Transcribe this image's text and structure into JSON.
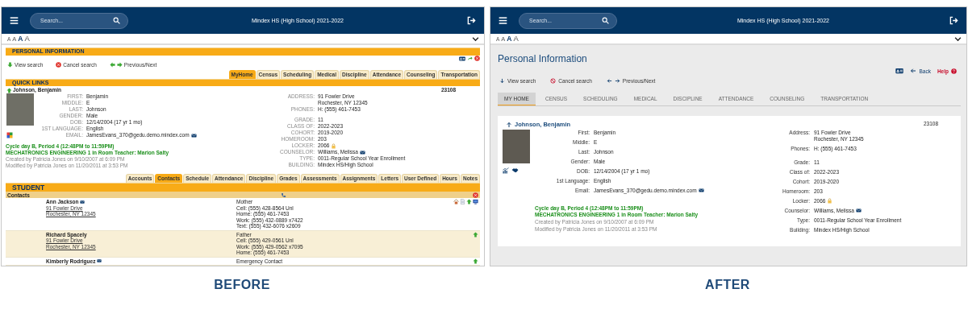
{
  "before": {
    "header": {
      "search_placeholder": "Search...",
      "title": "Mindex HS (High School) 2021-2022"
    },
    "font_sizes": [
      {
        "label": "A",
        "selected": false
      },
      {
        "label": "A",
        "selected": false
      },
      {
        "label": "A",
        "selected": true
      },
      {
        "label": "A",
        "selected": false
      }
    ],
    "section_title": "PERSONAL INFORMATION",
    "actions": [
      {
        "kind": "view",
        "label": "View search"
      },
      {
        "kind": "cancel",
        "label": "Cancel search"
      },
      {
        "kind": "prevnext",
        "label": "Previous/Next"
      }
    ],
    "tabs": [
      {
        "label": "MyHome",
        "selected": true
      },
      {
        "label": "Census",
        "selected": false
      },
      {
        "label": "Scheduling",
        "selected": false
      },
      {
        "label": "Medical",
        "selected": false
      },
      {
        "label": "Discipline",
        "selected": false
      },
      {
        "label": "Attendance",
        "selected": false
      },
      {
        "label": "Counseling",
        "selected": false
      },
      {
        "label": "Transportation",
        "selected": false
      }
    ],
    "quick_links_title": "QUICK LINKS",
    "student_name": "Johnson, Benjamin",
    "student_id": "23108",
    "left_fields": [
      {
        "kind": "text",
        "label": "FIRST:",
        "value": "Benjamin"
      },
      {
        "kind": "text",
        "label": "MIDDLE:",
        "value": "E"
      },
      {
        "kind": "text",
        "label": "LAST:",
        "value": "Johnson"
      },
      {
        "kind": "text",
        "label": "GENDER:",
        "value": "Male"
      },
      {
        "kind": "text",
        "label": "DOB:",
        "value": "12/14/2004 (17 yr 1 mo)"
      },
      {
        "kind": "text",
        "label": "1ST LANGUAGE:",
        "value": "English"
      },
      {
        "kind": "mail",
        "label": "EMAIL:",
        "value": "JamesEvans_370@gedu.demo.mindex.com"
      }
    ],
    "right_groups": [
      [
        {
          "kind": "text",
          "label": "ADDRESS:",
          "value": "91 Fowler Drive\nRochester, NY 12345"
        },
        {
          "kind": "text",
          "label": "PHONES:",
          "value": "H: (555) 461-7453"
        }
      ],
      [
        {
          "kind": "text",
          "label": "GRADE:",
          "value": "11"
        },
        {
          "kind": "text",
          "label": "CLASS OF:",
          "value": "2022-2023"
        },
        {
          "kind": "text",
          "label": "COHORT:",
          "value": "2019-2020"
        },
        {
          "kind": "text",
          "label": "HOMEROOM:",
          "value": "203"
        },
        {
          "kind": "lock",
          "label": "LOCKER:",
          "value": "2066"
        },
        {
          "kind": "mail",
          "label": "COUNSELOR:",
          "value": "Williams, Melissa"
        },
        {
          "kind": "text",
          "label": "TYPE:",
          "value": "0011-Regular School Year Enrollment"
        },
        {
          "kind": "text",
          "label": "BUILDING:",
          "value": "Mindex HS/High School"
        }
      ]
    ],
    "schedule_lines": [
      "Cycle day B, Period 4 (12:48PM to 11:59PM)",
      "MECHATRONICS ENGINEERING 1 in Room Teacher: Marion Salty"
    ],
    "audit_lines": [
      "Created by Patricia Jones on 9/10/2007 at 6:09 PM",
      "Modified by Patricia Jones on 11/20/2011 at 3:53 PM"
    ],
    "student_tabs": [
      {
        "label": "Accounts",
        "selected": false
      },
      {
        "label": "Contacts",
        "selected": true
      },
      {
        "label": "Schedule",
        "selected": false
      },
      {
        "label": "Attendance",
        "selected": false
      },
      {
        "label": "Discipline",
        "selected": false
      },
      {
        "label": "Grades",
        "selected": false
      },
      {
        "label": "Assessments",
        "selected": false
      },
      {
        "label": "Assignments",
        "selected": false
      },
      {
        "label": "Letters",
        "selected": false
      },
      {
        "label": "User Defined",
        "selected": false
      },
      {
        "label": "Hours",
        "selected": false
      },
      {
        "label": "Notes",
        "selected": false
      }
    ],
    "student_title": "STUDENT",
    "contacts_title": "Contacts",
    "contacts": [
      {
        "name": "Ann Jackson",
        "emailable": true,
        "primary": true,
        "address": "91 Fowler Drive\nRochester, NY 12345",
        "relation": "Mother",
        "phones": [
          "Cell: (555) 428-8564 Unl",
          "Home: (555) 461-7453",
          "Work: (555) 432-0889 x7422",
          "Text: (555) 432-6076 x2609"
        ]
      },
      {
        "name": "Richard Spacely",
        "emailable": false,
        "primary": false,
        "address": "91 Fowler Drive\nRochester, NY 12345",
        "relation": "Father",
        "phones": [
          "Cell: (555) 429-0561 Unl",
          "Work: (555) 429-0562 x7095",
          "Home: (555) 461-7453"
        ]
      },
      {
        "name": "Kimberly Rodriguez",
        "emailable": true,
        "primary": false,
        "relation": "Emergency Contact"
      }
    ]
  },
  "after": {
    "header": {
      "search_placeholder": "Search...",
      "title": "Mindex HS (High School) 2021-2022"
    },
    "font_sizes": [
      {
        "label": "A",
        "selected": false
      },
      {
        "label": "A",
        "selected": false
      },
      {
        "label": "A",
        "selected": true
      },
      {
        "label": "A",
        "selected": false
      }
    ],
    "page_title": "Personal Information",
    "back_label": "Back",
    "help_label": "Help",
    "actions": [
      {
        "kind": "view",
        "label": "View search"
      },
      {
        "kind": "cancel",
        "label": "Cancel search"
      },
      {
        "kind": "prevnext",
        "label": "Previous/Next"
      }
    ],
    "tabs": [
      {
        "label": "MY HOME",
        "selected": true
      },
      {
        "label": "CENSUS",
        "selected": false
      },
      {
        "label": "SCHEDULING",
        "selected": false
      },
      {
        "label": "MEDICAL",
        "selected": false
      },
      {
        "label": "DISCIPLINE",
        "selected": false
      },
      {
        "label": "ATTENDANCE",
        "selected": false
      },
      {
        "label": "COUNSELING",
        "selected": false
      },
      {
        "label": "TRANSPORTATION",
        "selected": false
      }
    ],
    "student_name": "Johnson, Benjamin",
    "student_id": "23108",
    "left_fields": [
      {
        "kind": "text",
        "label": "First:",
        "value": "Benjamin"
      },
      {
        "kind": "text",
        "label": "Middle:",
        "value": "E"
      },
      {
        "kind": "text",
        "label": "Last:",
        "value": "Johnson"
      },
      {
        "kind": "text",
        "label": "Gender:",
        "value": "Male"
      },
      {
        "kind": "text",
        "label": "DOB:",
        "value": "12/14/2004 (17 yr 1 mo)"
      },
      {
        "kind": "text",
        "label": "1st Language:",
        "value": "English"
      },
      {
        "kind": "mail",
        "label": "Email:",
        "value": "JamesEvans_370@gedu.demo.mindex.com"
      }
    ],
    "right_groups": [
      [
        {
          "kind": "text",
          "label": "Address:",
          "value": "91 Fowler Drive\nRochester, NY 12345"
        },
        {
          "kind": "text",
          "label": "Phones:",
          "value": "H:  (555) 461-7453"
        }
      ],
      [
        {
          "kind": "text",
          "label": "Grade:",
          "value": "11"
        },
        {
          "kind": "text",
          "label": "Class of:",
          "value": "2022-2023"
        },
        {
          "kind": "text",
          "label": "Cohort:",
          "value": "2019-2020"
        },
        {
          "kind": "text",
          "label": "Homeroom:",
          "value": "203"
        },
        {
          "kind": "lock",
          "label": "Locker:",
          "value": "2066"
        },
        {
          "kind": "mail",
          "label": "Counselor:",
          "value": "Williams, Melissa"
        },
        {
          "kind": "text",
          "label": "Type:",
          "value": "0011-Regular School Year Enrollment"
        },
        {
          "kind": "text",
          "label": "Building:",
          "value": "Mindex HS/High School"
        }
      ]
    ],
    "schedule_lines": [
      "Cycle day B, Period 4 (12:48PM to 11:59PM)",
      "MECHATRONICS ENGINEERING 1 in Room Teacher: Marion Salty"
    ],
    "audit_lines": [
      "Created by Patricia Jones on 9/10/2007 at 6:09 PM",
      "Modified by Patricia Jones on 11/20/2011 at 3:53 PM"
    ]
  },
  "captions": [
    "BEFORE",
    "AFTER"
  ]
}
